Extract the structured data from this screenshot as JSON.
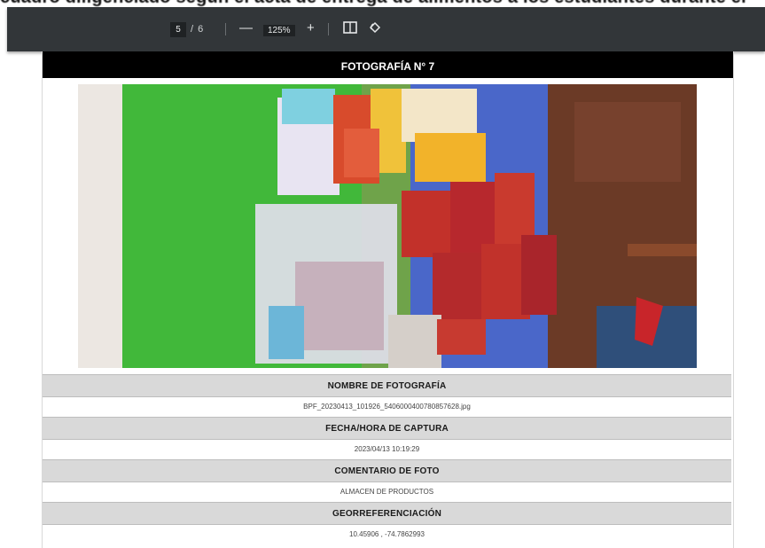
{
  "document": {
    "top_bleed_text": "cuadro diligenciado segun el acta de entrega de alimentos a los estudiantes durante el"
  },
  "toolbar": {
    "page_current": "5",
    "page_separator": "/",
    "page_total": "6",
    "zoom_out_label": "—",
    "zoom_value": "125%",
    "zoom_in_label": "+",
    "fit_icon": "fit-page-icon",
    "rotate_icon": "rotate-icon"
  },
  "photo_section": {
    "header": "FOTOGRAFÍA N° 7",
    "fields": [
      {
        "label": "NOMBRE DE FOTOGRAFÍA",
        "value": "BPF_20230413_101926_5406000400780857628.jpg"
      },
      {
        "label": "FECHA/HORA DE CAPTURA",
        "value": "2023/04/13 10:19:29"
      },
      {
        "label": "COMENTARIO DE FOTO",
        "value": "ALMACEN DE PRODUCTOS"
      },
      {
        "label": "GEORREFERENCIACIÓN",
        "value": "10.45906 , -74.7862993"
      }
    ]
  },
  "colors": {
    "toolbar": "#323639",
    "header": "#000000",
    "label_row": "#d9d9d9",
    "green_table": "#41b83a",
    "blue_table": "#4a67c9",
    "wood": "#6b3a26"
  }
}
